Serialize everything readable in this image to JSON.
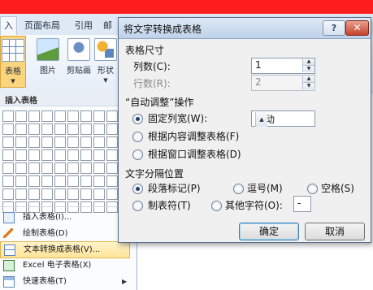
{
  "ribbon": {
    "tabs": [
      {
        "label": "入"
      },
      {
        "label": "页面布局"
      },
      {
        "label": "引用"
      },
      {
        "label": "邮"
      }
    ],
    "buttons": {
      "table": "表格",
      "picture": "图片",
      "clipart": "剪贴画",
      "shapes": "形状"
    }
  },
  "insert_table_menu": {
    "header": "插入表格",
    "grid_cols": 10,
    "grid_rows": 8,
    "items": [
      {
        "label": "插入表格(I)...",
        "icon": "table-icon"
      },
      {
        "label": "绘制表格(D)",
        "icon": "pencil-icon"
      },
      {
        "label": "文本转换成表格(V)...",
        "icon": "convert-text-table-icon",
        "highlighted": true
      },
      {
        "label": "Excel 电子表格(X)",
        "icon": "excel-icon"
      },
      {
        "label": "快速表格(T)",
        "icon": "quick-table-icon"
      }
    ]
  },
  "dialog": {
    "title": "将文字转换成表格",
    "help": "?",
    "close": "✕",
    "size_section": "表格尺寸",
    "cols_label": "列数(C):",
    "cols_value": "1",
    "rows_label": "行数(R):",
    "rows_value": "2",
    "autofit_section": "“自动调整”操作",
    "autofit_options": [
      {
        "label": "固定列宽(W):",
        "selected": true
      },
      {
        "label": "根据内容调整表格(F)",
        "selected": false
      },
      {
        "label": "根据窗口调整表格(D)",
        "selected": false
      }
    ],
    "fixed_width_value": "自动",
    "separator_section": "文字分隔位置",
    "separators": {
      "paragraph": {
        "label": "段落标记(P)",
        "selected": true
      },
      "comma": {
        "label": "逗号(M)",
        "selected": false
      },
      "space": {
        "label": "空格(S)",
        "selected": false
      },
      "tab": {
        "label": "制表符(T)",
        "selected": false
      },
      "other": {
        "label": "其他字符(O):",
        "selected": false
      }
    },
    "other_char_value": "-",
    "ok": "确定",
    "cancel": "取消"
  }
}
